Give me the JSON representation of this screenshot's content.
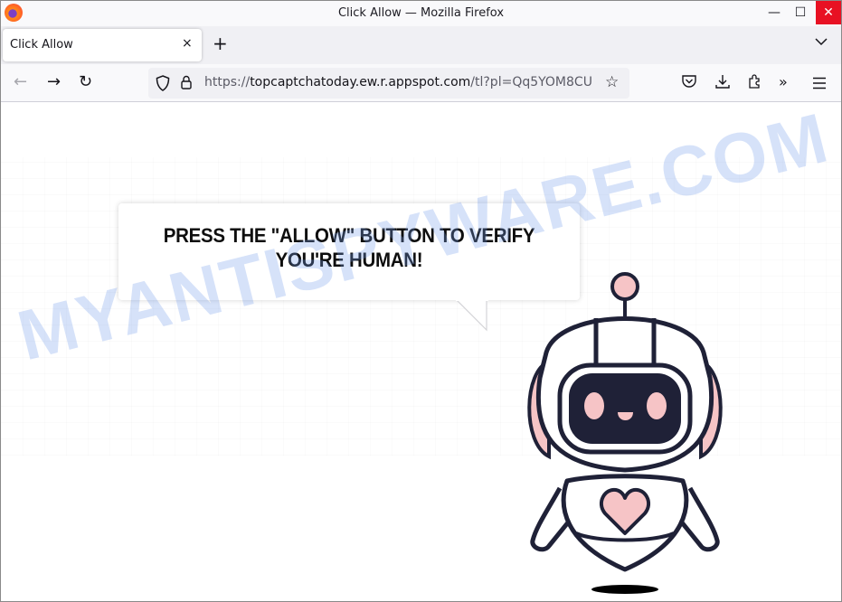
{
  "window": {
    "title": "Click Allow — Mozilla Firefox",
    "controls": {
      "minimize": "—",
      "maximize": "☐",
      "close": "✕"
    }
  },
  "tabs": [
    {
      "title": "Click Allow",
      "close": "×",
      "active": true
    }
  ],
  "tabstrip": {
    "new_tab": "+",
    "list_all_tabs": "⌄"
  },
  "nav": {
    "back": "←",
    "forward": "→",
    "reload": "↻",
    "url_scheme": "https://",
    "url_host": "topcaptchatoday.ew.r.appspot.com",
    "url_path": "/tl?pl=Qq5YOM8CU",
    "bookmark_star": "☆",
    "toolbar": {
      "pocket": "⛉",
      "downloads": "⤓",
      "extensions": "⧉",
      "more_tools": "»",
      "menu": "≡"
    }
  },
  "page": {
    "bubble_text_line1": "PRESS THE \"ALLOW\" BUTTON TO VERIFY",
    "bubble_text_line2": "YOU'RE HUMAN!",
    "watermark": "MYANTISPYWARE.COM"
  },
  "colors": {
    "close_button": "#e81123",
    "robot_outline": "#1f2137",
    "robot_accent": "#f6c4c6",
    "watermark": "#78a0eb"
  }
}
